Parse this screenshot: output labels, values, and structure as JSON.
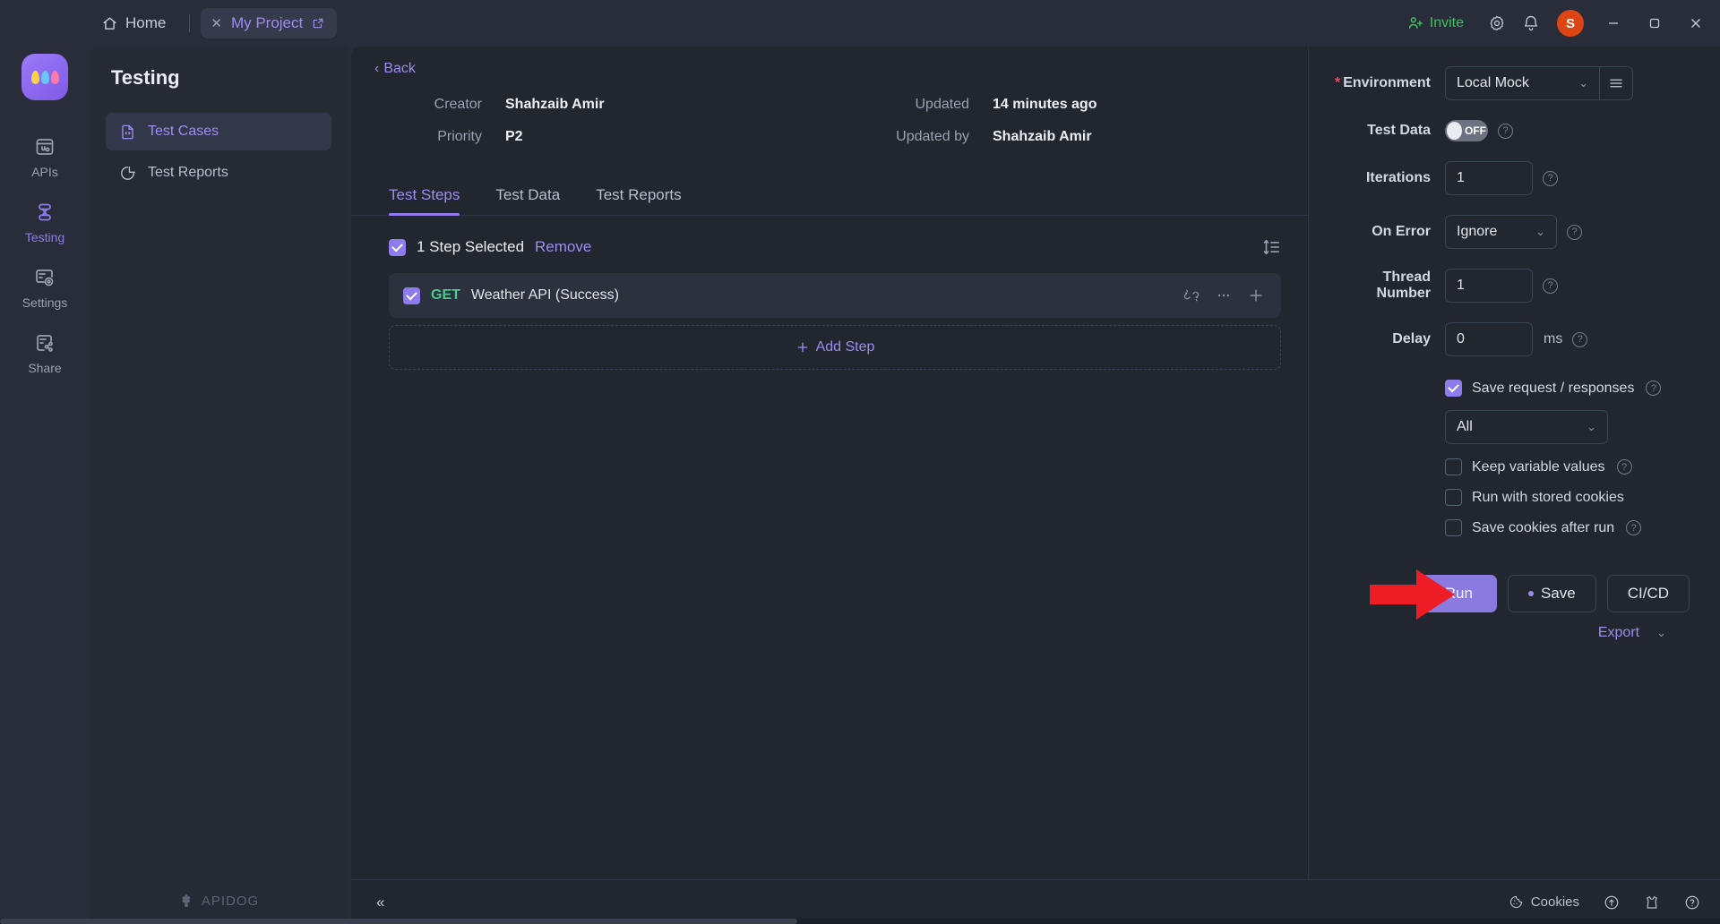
{
  "titlebar": {
    "home_label": "Home",
    "home_icon": "home-icon",
    "project_tab": "My Project",
    "project_close_icon": "close-icon",
    "project_external_icon": "external-link-icon",
    "invite_label": "Invite",
    "invite_icon": "user-plus-icon",
    "settings_icon": "gear-icon",
    "notifications_icon": "bell-icon",
    "avatar_initial": "S",
    "minimize_icon": "minimize-icon",
    "maximize_icon": "maximize-icon",
    "close_icon": "close-icon",
    "accent_green": "#3fbf5f",
    "avatar_color": "#dd4514"
  },
  "rail": {
    "logo_icon": "apidog-logo-icon",
    "items": [
      {
        "label": "APIs",
        "icon": "apis-icon",
        "active": false
      },
      {
        "label": "Testing",
        "icon": "testing-icon",
        "active": true
      },
      {
        "label": "Settings",
        "icon": "settings-icon",
        "active": false
      },
      {
        "label": "Share",
        "icon": "share-icon",
        "active": false
      }
    ]
  },
  "sidebar": {
    "title": "Testing",
    "items": [
      {
        "label": "Test Cases",
        "icon": "file-code-icon",
        "active": true
      },
      {
        "label": "Test Reports",
        "icon": "pie-chart-icon",
        "active": false
      }
    ],
    "footer_brand": "APIDOG"
  },
  "main": {
    "back_label": "Back",
    "back_icon": "chevron-left-icon",
    "meta_left": [
      {
        "key": "Creator",
        "value": "Shahzaib Amir"
      },
      {
        "key": "Priority",
        "value": "P2"
      }
    ],
    "meta_right": [
      {
        "key": "Updated",
        "value": "14 minutes ago"
      },
      {
        "key": "Updated by",
        "value": "Shahzaib Amir"
      }
    ],
    "tabs": [
      {
        "label": "Test Steps",
        "active": true
      },
      {
        "label": "Test Data",
        "active": false
      },
      {
        "label": "Test Reports",
        "active": false
      }
    ],
    "steps_header": {
      "selected_text": "1 Step Selected",
      "remove_label": "Remove",
      "checked": true,
      "sort_icon": "sort-icon"
    },
    "steps": [
      {
        "checked": true,
        "method": "GET",
        "name": "Weather API (Success)",
        "method_color": "#4ec98f",
        "link_icon": "broken-link-icon",
        "more_icon": "more-horizontal-icon",
        "add_icon": "plus-icon"
      }
    ],
    "add_step_label": "Add Step",
    "add_step_icon": "plus-icon"
  },
  "config": {
    "environment": {
      "label": "Environment",
      "required": true,
      "value": "Local Mock",
      "chevron_icon": "chevron-down-icon",
      "menu_icon": "hamburger-icon"
    },
    "test_data": {
      "label": "Test Data",
      "state": "OFF",
      "help_icon": "help-icon"
    },
    "iterations": {
      "label": "Iterations",
      "value": "1",
      "help_icon": "help-icon"
    },
    "on_error": {
      "label": "On Error",
      "value": "Ignore",
      "help_icon": "help-icon",
      "chevron_icon": "chevron-down-icon"
    },
    "thread_number": {
      "label": "Thread Number",
      "value": "1",
      "help_icon": "help-icon"
    },
    "delay": {
      "label": "Delay",
      "value": "0",
      "unit": "ms",
      "help_icon": "help-icon"
    },
    "save_requests": {
      "label": "Save request / responses",
      "checked": true,
      "help_icon": "help-icon"
    },
    "save_requests_scope": {
      "value": "All",
      "chevron_icon": "chevron-down-icon"
    },
    "keep_variables": {
      "label": "Keep variable values",
      "checked": false,
      "help_icon": "help-icon"
    },
    "stored_cookies": {
      "label": "Run with stored cookies",
      "checked": false
    },
    "save_cookies": {
      "label": "Save cookies after run",
      "checked": false,
      "help_icon": "help-icon"
    },
    "buttons": {
      "run": "Run",
      "save": "Save",
      "cicd": "CI/CD",
      "export": "Export",
      "export_chevron_icon": "chevron-down-icon"
    },
    "accent_purple": "#8b7ae0",
    "pointer_color": "#ee1c24"
  },
  "bottombar": {
    "collapse_icon": "double-chevron-left-icon",
    "cookies_label": "Cookies",
    "cookies_icon": "cookie-icon",
    "upload_icon": "upload-circle-icon",
    "shirt_icon": "shirt-icon",
    "help_icon": "help-circle-icon"
  }
}
